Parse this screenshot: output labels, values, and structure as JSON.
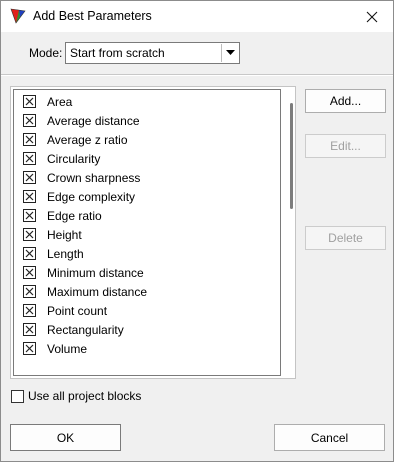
{
  "window": {
    "title": "Add Best Parameters"
  },
  "mode": {
    "label": "Mode:",
    "value": "Start from scratch"
  },
  "parameters": [
    {
      "label": "Area",
      "checked": true
    },
    {
      "label": "Average distance",
      "checked": true
    },
    {
      "label": "Average z ratio",
      "checked": true
    },
    {
      "label": "Circularity",
      "checked": true
    },
    {
      "label": "Crown sharpness",
      "checked": true
    },
    {
      "label": "Edge complexity",
      "checked": true
    },
    {
      "label": "Edge ratio",
      "checked": true
    },
    {
      "label": "Height",
      "checked": true
    },
    {
      "label": "Length",
      "checked": true
    },
    {
      "label": "Minimum distance",
      "checked": true
    },
    {
      "label": "Maximum distance",
      "checked": true
    },
    {
      "label": "Point count",
      "checked": true
    },
    {
      "label": "Rectangularity",
      "checked": true
    },
    {
      "label": "Volume",
      "checked": true
    }
  ],
  "buttons": {
    "add": "Add...",
    "edit": "Edit...",
    "delete": "Delete",
    "ok": "OK",
    "cancel": "Cancel"
  },
  "use_all_blocks": {
    "label": "Use all project blocks",
    "checked": false
  }
}
